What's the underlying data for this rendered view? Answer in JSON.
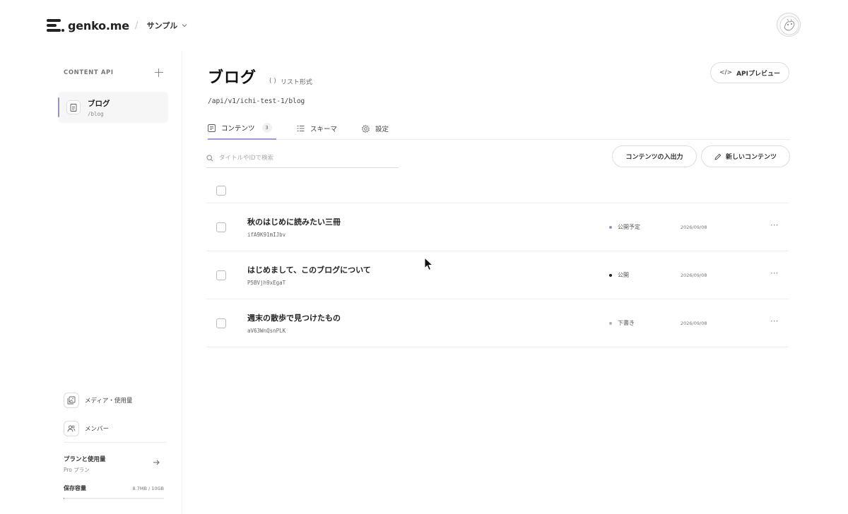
{
  "header": {
    "brand": "genko.me",
    "separator": "/",
    "project": "サンプル"
  },
  "sidebar": {
    "section_label": "CONTENT API",
    "items": [
      {
        "title": "ブログ",
        "path": "/blog"
      }
    ],
    "links": [
      {
        "label": "メディア・使用量",
        "icon": "media-icon"
      },
      {
        "label": "メンバー",
        "icon": "members-icon"
      }
    ],
    "plan": {
      "title": "プランと使用量",
      "subtitle": "Pro プラン"
    },
    "storage": {
      "label": "保存容量",
      "value": "8.7MB / 10GB",
      "fraction": 0.00087
    }
  },
  "main": {
    "title": "ブログ",
    "list_type": "リスト形式",
    "api_preview_label": "APIプレビュー",
    "endpoint": "/api/v1/ichi-test-1/blog",
    "tabs": [
      {
        "label": "コンテンツ",
        "count": "3",
        "active": true
      },
      {
        "label": "スキーマ"
      },
      {
        "label": "設定"
      }
    ],
    "search": {
      "placeholder": "タイトルやIDで検索"
    },
    "import_export_label": "コンテンツの入出力",
    "new_content_label": "新しいコンテンツ",
    "rows": [
      {
        "title": "秋のはじめに読みたい三冊",
        "id": "ifA9K91mIJbv",
        "status": "公開予定",
        "status_color": "#9b8fc9",
        "date": "2026/09/08"
      },
      {
        "title": "はじめまして、このブログについて",
        "id": "P5BVjh9xEgaT",
        "status": "公開",
        "status_color": "#222222",
        "date": "2026/09/08"
      },
      {
        "title": "週末の散歩で見つけたもの",
        "id": "aV63WnQsnPLK",
        "status": "下書き",
        "status_color": "#b0b0b0",
        "date": "2026/09/08"
      }
    ],
    "row_menu": "···"
  },
  "colors": {
    "accent": "#a497d4",
    "border": "#dddddd"
  }
}
